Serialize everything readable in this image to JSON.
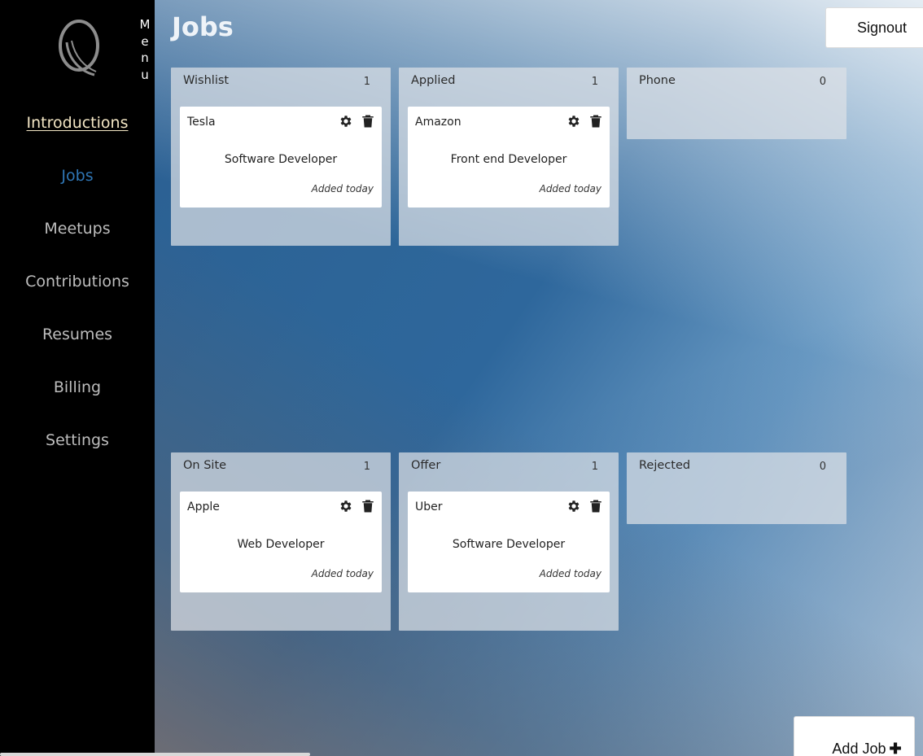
{
  "sidebar": {
    "menu_letters": [
      "M",
      "e",
      "n",
      "u"
    ],
    "nav": [
      {
        "label": "Introductions"
      },
      {
        "label": "Jobs"
      },
      {
        "label": "Meetups"
      },
      {
        "label": "Contributions"
      },
      {
        "label": "Resumes"
      },
      {
        "label": "Billing"
      },
      {
        "label": "Settings"
      }
    ]
  },
  "header": {
    "title": "Jobs",
    "signout_label": "Signout"
  },
  "board": {
    "columns": [
      {
        "title": "Wishlist",
        "count": "1",
        "card": {
          "company": "Tesla",
          "position": "Software Developer",
          "added": "Added today"
        }
      },
      {
        "title": "Applied",
        "count": "1",
        "card": {
          "company": "Amazon",
          "position": "Front end Developer",
          "added": "Added today"
        }
      },
      {
        "title": "Phone",
        "count": "0"
      },
      {
        "title": "On Site",
        "count": "1",
        "card": {
          "company": "Apple",
          "position": "Web Developer",
          "added": "Added today"
        }
      },
      {
        "title": "Offer",
        "count": "1",
        "card": {
          "company": "Uber",
          "position": "Software Developer",
          "added": "Added today"
        }
      },
      {
        "title": "Rejected",
        "count": "0"
      }
    ]
  },
  "add_job_label": "Add Job",
  "add_job_icon": "plus-icon",
  "colors": {
    "accent": "#2f76b5",
    "intro_link": "#f3e6c4"
  }
}
